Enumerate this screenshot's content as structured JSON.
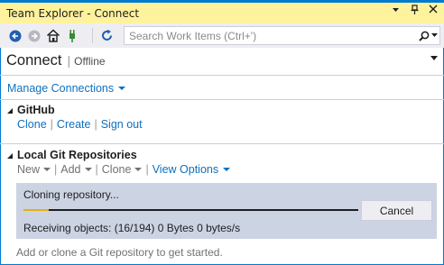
{
  "window": {
    "title": "Team Explorer - Connect",
    "title_icons": [
      "dropdown-icon",
      "pin-icon",
      "close-icon"
    ]
  },
  "toolbar": {
    "icons": [
      "back-icon",
      "forward-icon",
      "home-icon",
      "connect-plug-icon",
      "refresh-icon"
    ],
    "search_placeholder": "Search Work Items (Ctrl+')",
    "search_icon": "search-icon"
  },
  "page": {
    "title": "Connect",
    "status": "Offline"
  },
  "manage_connections": {
    "label": "Manage Connections"
  },
  "github": {
    "title": "GitHub",
    "links": [
      "Clone",
      "Create",
      "Sign out"
    ]
  },
  "local_repos": {
    "title": "Local Git Repositories",
    "actions": [
      "New",
      "Add",
      "Clone"
    ],
    "view_options": "View Options"
  },
  "clone": {
    "status": "Cloning repository...",
    "progress": 0.075,
    "receiving": "Receiving objects: (16/194) 0 Bytes 0 bytes/s",
    "cancel_label": "Cancel"
  },
  "hint": "Add or clone a Git repository to get started.",
  "colors": {
    "accent": "#007acc",
    "titlebar": "#fff29d",
    "link": "#0e70c0",
    "progress": "#e6b10f",
    "panel": "#ccd3e3"
  }
}
